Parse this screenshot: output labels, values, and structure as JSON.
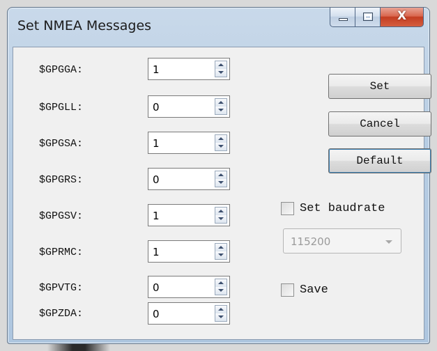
{
  "window": {
    "title": "Set NMEA Messages",
    "close_glyph": "X"
  },
  "messages": [
    {
      "label": "$GPGGA:",
      "value": "1"
    },
    {
      "label": "$GPGLL:",
      "value": "0"
    },
    {
      "label": "$GPGSA:",
      "value": "1"
    },
    {
      "label": "$GPGRS:",
      "value": "0"
    },
    {
      "label": "$GPGSV:",
      "value": "1"
    },
    {
      "label": "$GPRMC:",
      "value": "1"
    },
    {
      "label": "$GPVTG:",
      "value": "0"
    },
    {
      "label": "$GPZDA:",
      "value": "0"
    }
  ],
  "buttons": {
    "set": "Set",
    "cancel": "Cancel",
    "default": "Default"
  },
  "baudrate": {
    "checkbox_label": "Set baudrate",
    "checked": false,
    "selected": "115200",
    "enabled": false
  },
  "save": {
    "checkbox_label": "Save",
    "checked": false
  },
  "icons": {
    "minimize": "minimize-icon",
    "maximize": "maximize-icon",
    "close": "close-icon",
    "spin_up": "spin-up-icon",
    "spin_down": "spin-down-icon",
    "dropdown": "chevron-down-icon"
  },
  "colors": {
    "titlebar": "#b7cde3",
    "close_button": "#c33d22",
    "client_bg": "#f0f0f0"
  }
}
